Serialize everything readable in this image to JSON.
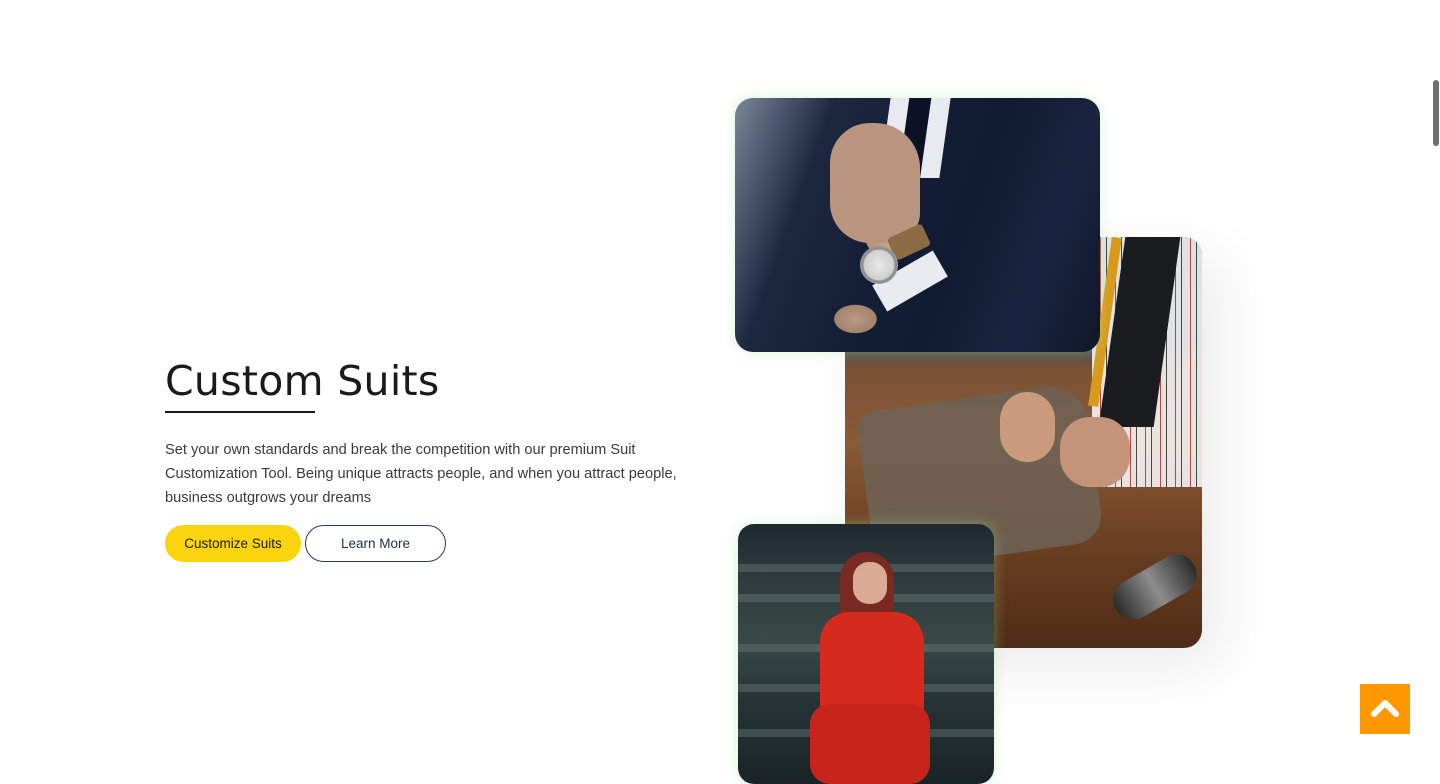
{
  "hero": {
    "title": "Custom Suits",
    "description": "Set your own standards and break the competition with our premium Suit Customization Tool. Being unique attracts people, and when you attract people, business outgrows your dreams",
    "primary_button": "Customize Suits",
    "secondary_button": "Learn More"
  },
  "colors": {
    "primary_button_bg": "#fad40f",
    "outline_border": "#2a3a5e",
    "back_to_top_bg": "#ff9800"
  },
  "icons": {
    "back_to_top": "chevron-up-icon"
  }
}
